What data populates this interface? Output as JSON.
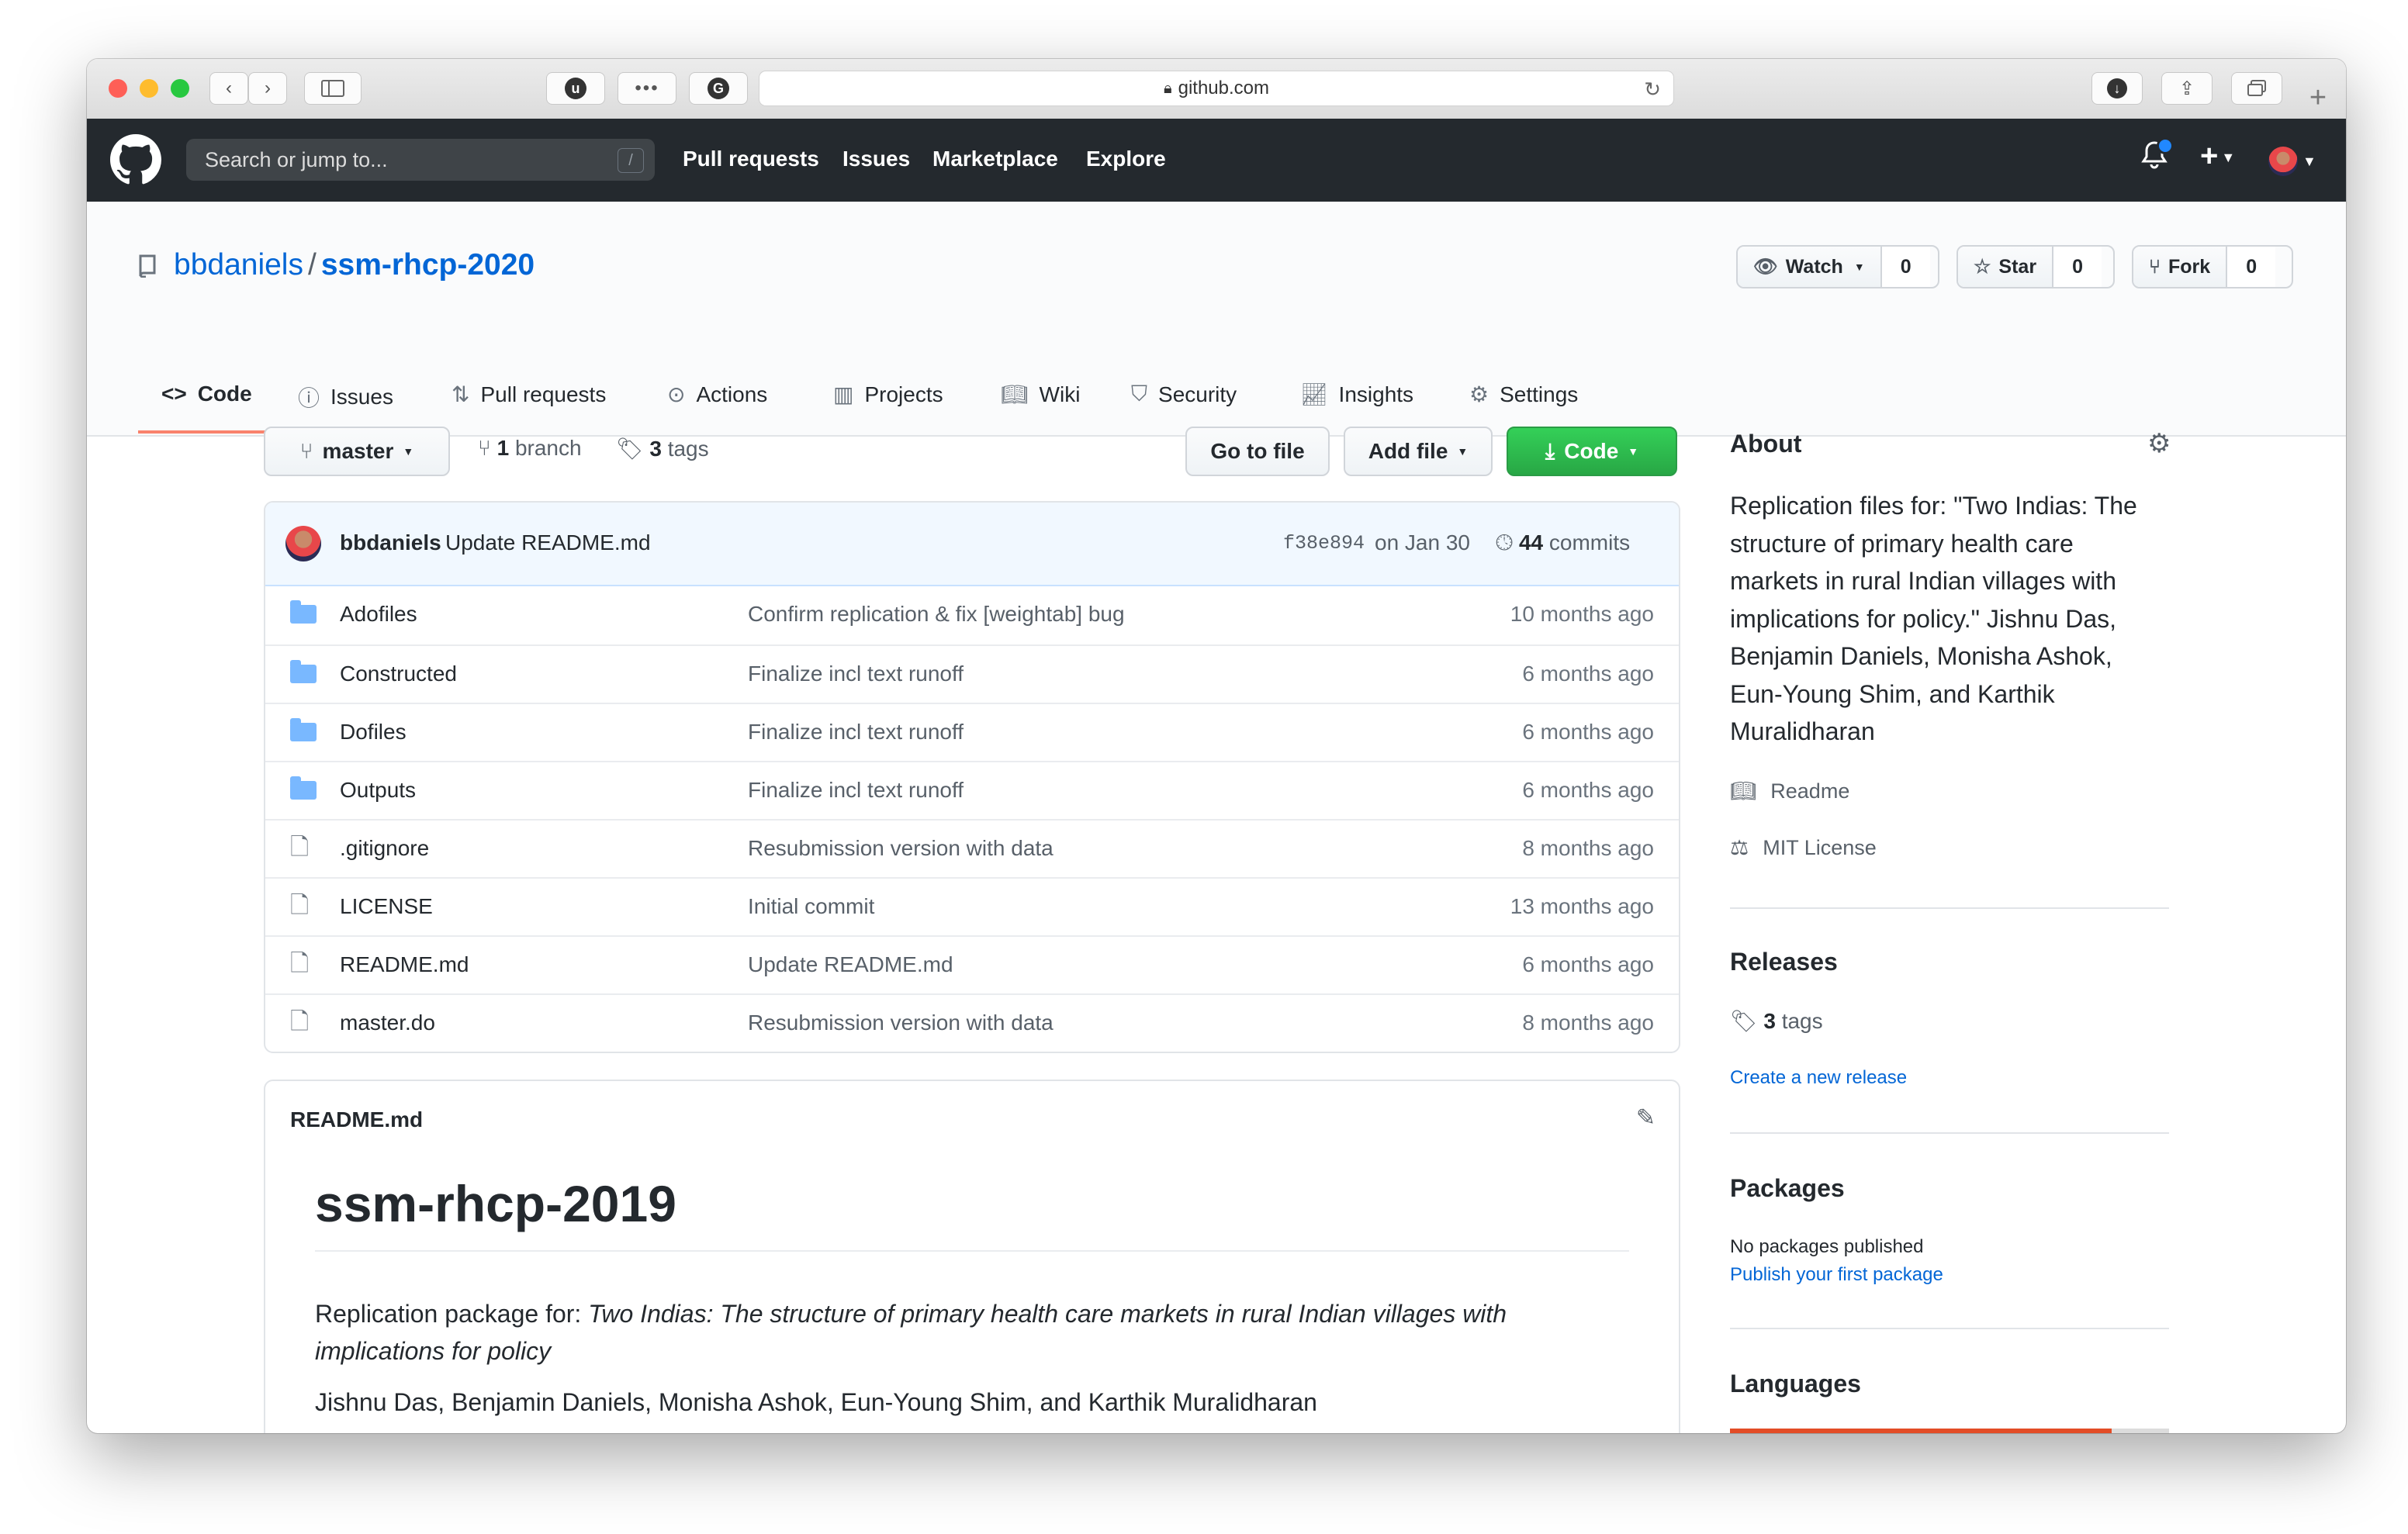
{
  "browser": {
    "url": "github.com",
    "colors": {
      "close": "#fe5f57",
      "minimize": "#febc2e",
      "zoom": "#28c840"
    }
  },
  "header": {
    "search_placeholder": "Search or jump to...",
    "search_shortcut": "/",
    "nav": [
      "Pull requests",
      "Issues",
      "Marketplace",
      "Explore"
    ],
    "new_label": "+"
  },
  "repo": {
    "owner": "bbdaniels",
    "separator": "/",
    "name": "ssm-rhcp-2020",
    "watch": {
      "label": "Watch",
      "count": "0"
    },
    "star": {
      "label": "Star",
      "count": "0"
    },
    "fork": {
      "label": "Fork",
      "count": "0"
    }
  },
  "tabs": [
    {
      "label": "Code",
      "icon": "code-icon"
    },
    {
      "label": "Issues",
      "icon": "issue-icon"
    },
    {
      "label": "Pull requests",
      "icon": "pull-request-icon"
    },
    {
      "label": "Actions",
      "icon": "play-icon"
    },
    {
      "label": "Projects",
      "icon": "project-icon"
    },
    {
      "label": "Wiki",
      "icon": "book-icon"
    },
    {
      "label": "Security",
      "icon": "shield-icon"
    },
    {
      "label": "Insights",
      "icon": "graph-icon"
    },
    {
      "label": "Settings",
      "icon": "gear-icon"
    }
  ],
  "toolbar": {
    "branch": "master",
    "branch_count": "1",
    "branch_label": "branch",
    "tag_count": "3",
    "tag_label": "tags",
    "go_to_file": "Go to file",
    "add_file": "Add file",
    "code": "Code"
  },
  "commit": {
    "author": "bbdaniels",
    "message": "Update README.md",
    "sha": "f38e894",
    "date": "on Jan 30",
    "count": "44",
    "count_label": "commits"
  },
  "files": [
    {
      "type": "dir",
      "name": "Adofiles",
      "message": "Confirm replication & fix [weightab] bug",
      "age": "10 months ago"
    },
    {
      "type": "dir",
      "name": "Constructed",
      "message": "Finalize incl text runoff",
      "age": "6 months ago"
    },
    {
      "type": "dir",
      "name": "Dofiles",
      "message": "Finalize incl text runoff",
      "age": "6 months ago"
    },
    {
      "type": "dir",
      "name": "Outputs",
      "message": "Finalize incl text runoff",
      "age": "6 months ago"
    },
    {
      "type": "file",
      "name": ".gitignore",
      "message": "Resubmission version with data",
      "age": "8 months ago"
    },
    {
      "type": "file",
      "name": "LICENSE",
      "message": "Initial commit",
      "age": "13 months ago"
    },
    {
      "type": "file",
      "name": "README.md",
      "message": "Update README.md",
      "age": "6 months ago"
    },
    {
      "type": "file",
      "name": "master.do",
      "message": "Resubmission version with data",
      "age": "8 months ago"
    }
  ],
  "readme": {
    "filename": "README.md",
    "title": "ssm-rhcp-2019",
    "para1_prefix": "Replication package for: ",
    "para1_italic": "Two Indias: The structure of primary health care markets in rural Indian villages with implications for policy",
    "authors": "Jishnu Das, Benjamin Daniels, Monisha Ashok, Eun-Young Shim, and Karthik Muralidharan"
  },
  "sidebar": {
    "about_title": "About",
    "about_text": "Replication files for: \"Two Indias: The structure of primary health care markets in rural Indian villages with implications for policy.\" Jishnu Das, Benjamin Daniels, Monisha Ashok, Eun-Young Shim, and Karthik Muralidharan",
    "readme_label": "Readme",
    "license_label": "MIT License",
    "releases_title": "Releases",
    "releases_count": "3",
    "releases_label": "tags",
    "create_release": "Create a new release",
    "packages_title": "Packages",
    "packages_none": "No packages published",
    "publish_package": "Publish your first package",
    "languages_title": "Languages",
    "language_colors": [
      "#e34c26",
      "#dcdcdc"
    ]
  }
}
